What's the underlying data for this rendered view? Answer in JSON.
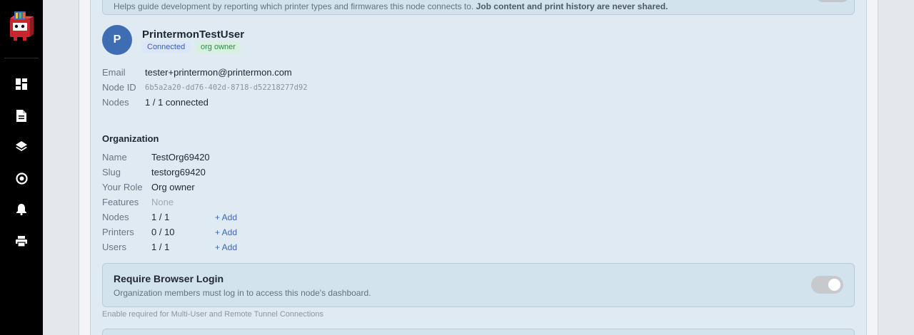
{
  "sidebar": {
    "icons": [
      {
        "name": "dashboard-icon"
      },
      {
        "name": "document-icon"
      },
      {
        "name": "layers-icon"
      },
      {
        "name": "target-icon"
      },
      {
        "name": "bell-icon"
      },
      {
        "name": "printer-icon"
      }
    ]
  },
  "banner": {
    "text": "Helps guide development by reporting which printer types and firmwares this node connects to.",
    "bold_text": "Job content and print history are never shared."
  },
  "user": {
    "avatar_letter": "P",
    "name": "PrintermonTestUser",
    "badges": {
      "connected": "Connected",
      "role": "org owner"
    },
    "fields": {
      "email_label": "Email",
      "email_value": "tester+printermon@printermon.com",
      "node_id_label": "Node ID",
      "node_id_value": "6b5a2a20-dd76-402d-8718-d52218277d92",
      "nodes_label": "Nodes",
      "nodes_value": "1 / 1 connected"
    }
  },
  "organization": {
    "title": "Organization",
    "name_label": "Name",
    "name_value": "TestOrg69420",
    "slug_label": "Slug",
    "slug_value": "testorg69420",
    "role_label": "Your Role",
    "role_value": "Org owner",
    "features_label": "Features",
    "features_value": "None",
    "nodes_label": "Nodes",
    "nodes_value": "1 / 1",
    "printers_label": "Printers",
    "printers_value": "0 / 10",
    "users_label": "Users",
    "users_value": "1 / 1",
    "add_label": "+ Add"
  },
  "login_card": {
    "title": "Require Browser Login",
    "description": "Organization members must log in to access this node's dashboard.",
    "toggle_on": false
  },
  "hint": "Enable required for Multi-User and Remote Tunnel Connections",
  "colors": {
    "sidebar": "#000000",
    "avatar": "#3f6db3",
    "link": "#3a67b8",
    "connected_badge_bg": "#dde6f6",
    "owner_badge_bg": "#d7f0df"
  }
}
